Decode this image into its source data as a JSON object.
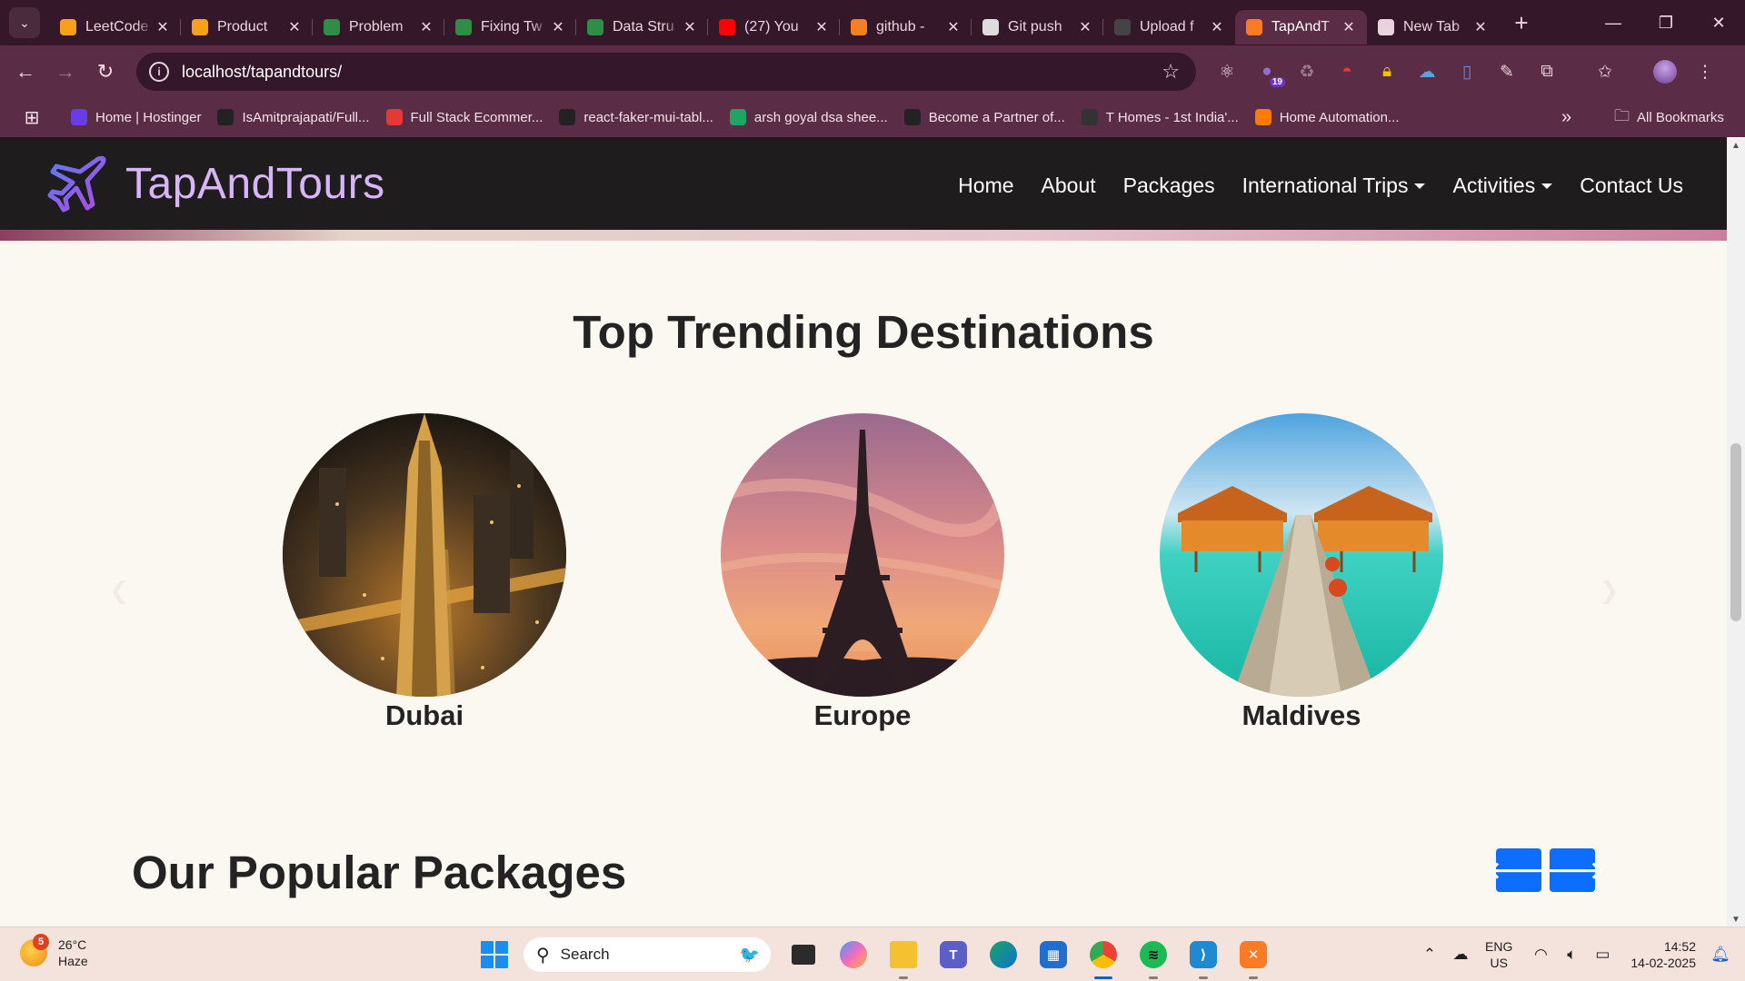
{
  "browser": {
    "tabs": [
      {
        "title": "LeetCode",
        "icon": "leetcode-icon",
        "color": "#f89f1b"
      },
      {
        "title": "Product",
        "icon": "leetcode-icon",
        "color": "#f89f1b"
      },
      {
        "title": "Problem",
        "icon": "gfg-icon",
        "color": "#2f8d46"
      },
      {
        "title": "Fixing Tw",
        "icon": "gfg-icon",
        "color": "#2f8d46"
      },
      {
        "title": "Data Stru",
        "icon": "gfg-icon",
        "color": "#2f8d46"
      },
      {
        "title": "(27) You",
        "icon": "youtube-icon",
        "color": "#ff0000"
      },
      {
        "title": "github -",
        "icon": "stackoverflow-icon",
        "color": "#f48024"
      },
      {
        "title": "Git push",
        "icon": "chatgpt-icon",
        "color": "#dddddd"
      },
      {
        "title": "Upload f",
        "icon": "github-icon",
        "color": "#444444"
      },
      {
        "title": "TapAndT",
        "icon": "xampp-icon",
        "color": "#fb7a24",
        "active": true
      },
      {
        "title": "New Tab",
        "icon": "chrome-icon",
        "color": "#e8d4dd"
      }
    ],
    "url": "localhost/tapandtours/",
    "extension_badge": "19",
    "bookmarks": [
      {
        "label": "Home | Hostinger",
        "color": "#673de6"
      },
      {
        "label": "IsAmitprajapati/Full...",
        "color": "#222222"
      },
      {
        "label": "Full Stack Ecommer...",
        "color": "#e53935"
      },
      {
        "label": "react-faker-mui-tabl...",
        "color": "#222222"
      },
      {
        "label": "arsh goyal dsa shee...",
        "color": "#1fa463"
      },
      {
        "label": "Become a Partner of...",
        "color": "#222222"
      },
      {
        "label": "T Homes - 1st India'...",
        "color": "#333333"
      },
      {
        "label": "Home Automation...",
        "color": "#ff7a00"
      }
    ],
    "all_bookmarks": "All Bookmarks"
  },
  "site": {
    "brand": "TapAndTours",
    "nav": [
      "Home",
      "About",
      "Packages",
      "International Trips",
      "Activities",
      "Contact Us"
    ],
    "trending_title": "Top Trending Destinations",
    "destinations": [
      "Dubai",
      "Europe",
      "Maldives"
    ],
    "packages_title": "Our Popular Packages"
  },
  "taskbar": {
    "weather_temp": "26°C",
    "weather_desc": "Haze",
    "weather_alerts": "5",
    "search_placeholder": "Search",
    "lang_line1": "ENG",
    "lang_line2": "US",
    "time": "14:52",
    "date": "14-02-2025"
  }
}
